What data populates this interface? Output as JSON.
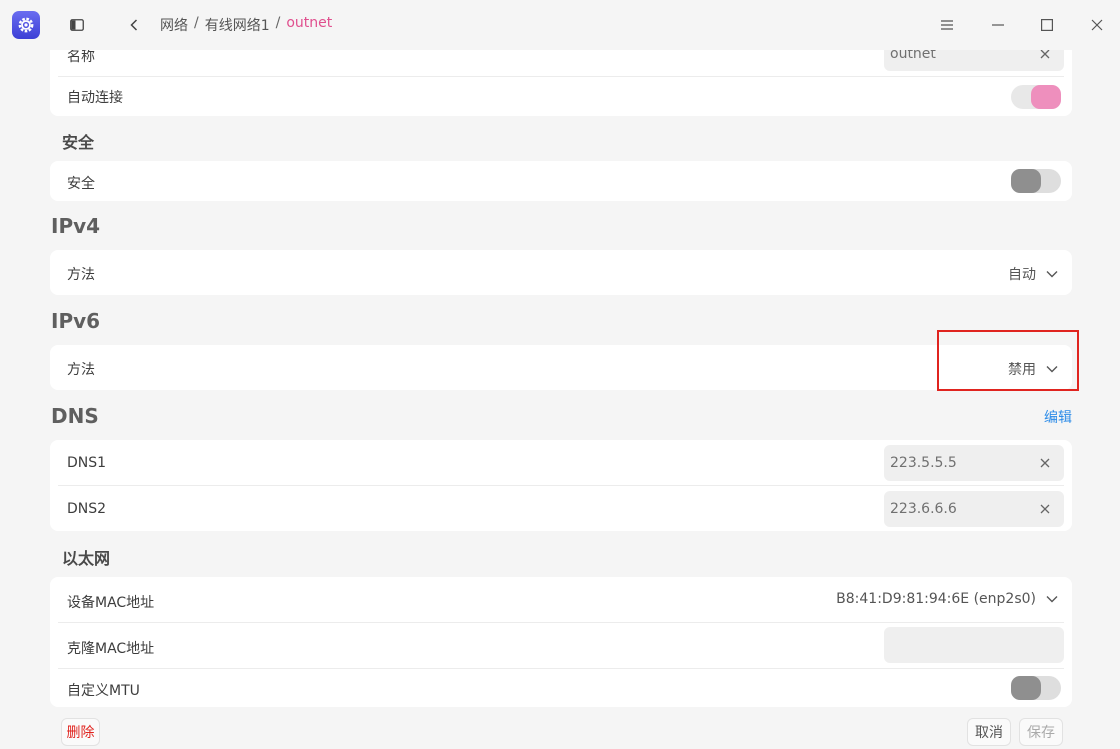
{
  "titlebar": {
    "breadcrumb": [
      "网络",
      "有线网络1",
      "outnet"
    ],
    "separator": "/"
  },
  "general": {
    "name_label": "名称",
    "name_value": "outnet",
    "auto_connect_label": "自动连接",
    "auto_connect_on": true
  },
  "security": {
    "section_title": "安全",
    "label": "安全",
    "enabled": false
  },
  "ipv4": {
    "section_title": "IPv4",
    "method_label": "方法",
    "method_value": "自动"
  },
  "ipv6": {
    "section_title": "IPv6",
    "method_label": "方法",
    "method_value": "禁用"
  },
  "dns": {
    "section_title": "DNS",
    "edit_label": "编辑",
    "dns1_label": "DNS1",
    "dns1_value": "223.5.5.5",
    "dns2_label": "DNS2",
    "dns2_value": "223.6.6.6"
  },
  "ethernet": {
    "section_title": "以太网",
    "mac_label": "设备MAC地址",
    "mac_value": "B8:41:D9:81:94:6E (enp2s0)",
    "clone_mac_label": "克隆MAC地址",
    "clone_mac_value": "",
    "mtu_label": "自定义MTU",
    "mtu_enabled": false
  },
  "footer": {
    "delete_label": "删除",
    "cancel_label": "取消",
    "save_label": "保存"
  },
  "colors": {
    "accent": "#e04f8e",
    "toggle_on": "#ee8fbd",
    "link": "#2d8ce8",
    "danger": "#e0241f"
  }
}
